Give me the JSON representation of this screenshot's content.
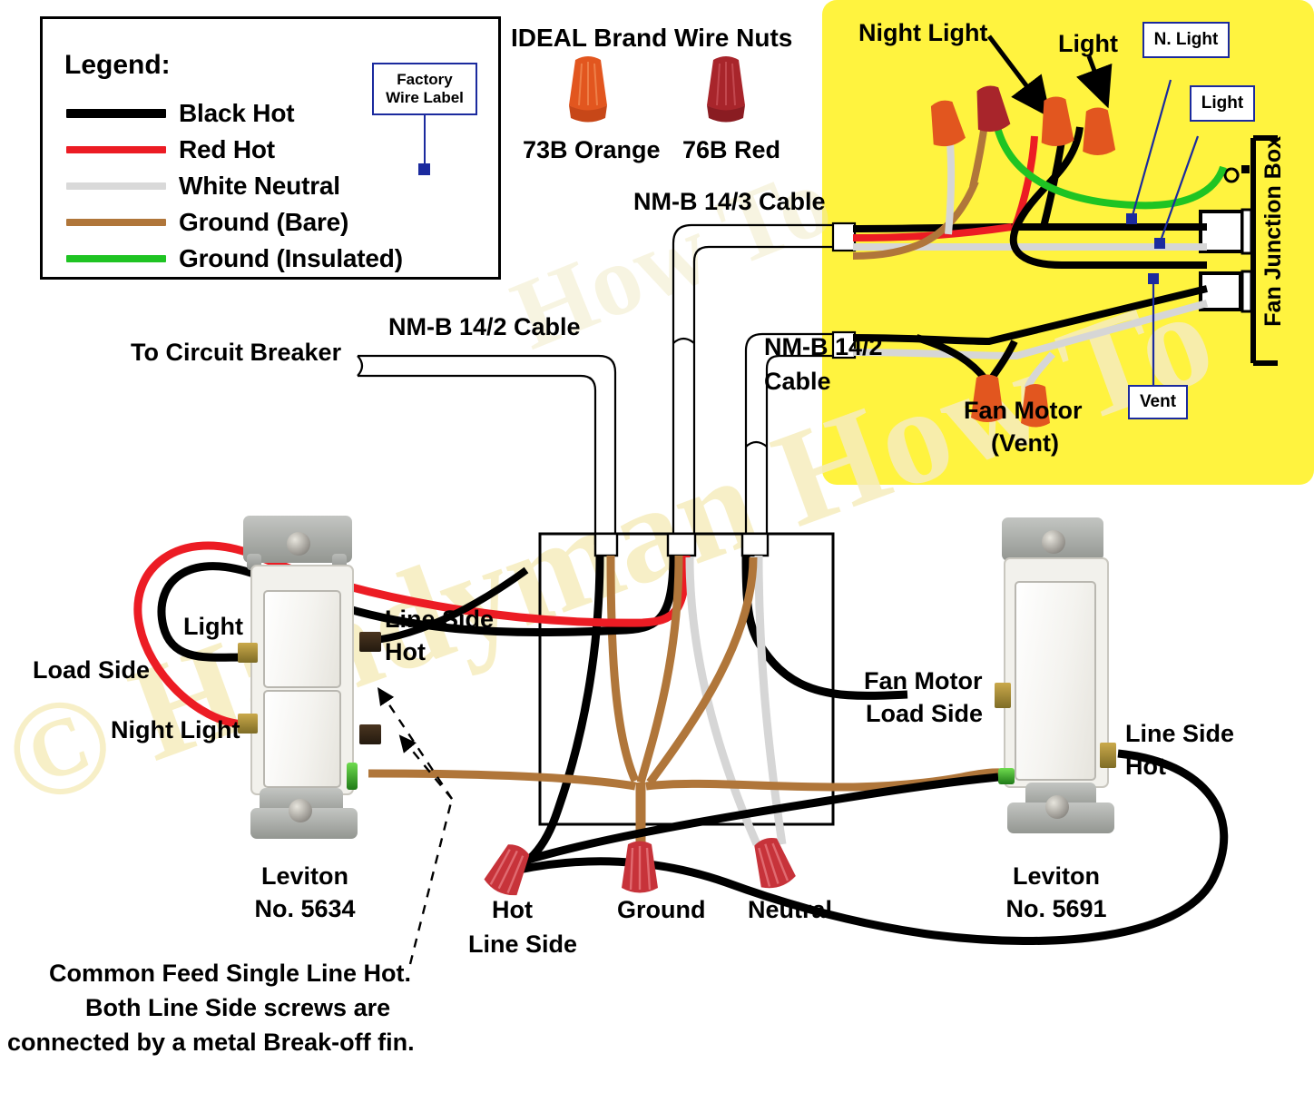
{
  "legend": {
    "title": "Legend:",
    "items": [
      {
        "label": "Black Hot",
        "color": "#000000"
      },
      {
        "label": "Red Hot",
        "color": "#ec1c24"
      },
      {
        "label": "White Neutral",
        "color": "#d9d9d9"
      },
      {
        "label": "Ground (Bare)",
        "color": "#b0763a"
      },
      {
        "label": "Ground (Insulated)",
        "color": "#1fc423"
      }
    ],
    "factory_label_line1": "Factory",
    "factory_label_line2": "Wire Label"
  },
  "wire_nuts": {
    "title": "IDEAL Brand Wire Nuts",
    "orange_caption": "73B Orange",
    "red_caption": "76B Red",
    "orange_color": "#e2561f",
    "red_color": "#a8252b"
  },
  "cables": {
    "to_breaker": "To Circuit Breaker",
    "nmb_14_2_top": "NM-B 14/2 Cable",
    "nmb_14_3": "NM-B 14/3 Cable",
    "nmb_14_2_right_line1": "NM-B 14/2",
    "nmb_14_2_right_line2": "Cable"
  },
  "fan_box": {
    "background": "#fff33f",
    "night_light": "Night Light",
    "light": "Light",
    "fan_motor_line1": "Fan Motor",
    "fan_motor_line2": "(Vent)",
    "junction_box_label": "Fan Junction Box",
    "callouts": [
      {
        "name": "n-light",
        "label": "N. Light"
      },
      {
        "name": "light",
        "label": "Light"
      },
      {
        "name": "vent",
        "label": "Vent"
      }
    ]
  },
  "left_switch": {
    "brand": "Leviton",
    "model": "No. 5634",
    "load_side": "Load Side",
    "light_terminal": "Light",
    "night_light_terminal": "Night Light",
    "line_side_line1": "Line Side",
    "line_side_line2": "Hot"
  },
  "right_switch": {
    "brand": "Leviton",
    "model": "No. 5691",
    "fan_motor_line1": "Fan Motor",
    "fan_motor_line2": "Load Side",
    "line_side_line1": "Line Side",
    "line_side_line2": "Hot"
  },
  "splices": {
    "hot_line1": "Hot",
    "hot_line2": "Line Side",
    "ground": "Ground",
    "neutral": "Neutral"
  },
  "footnote": {
    "line1": "Common Feed Single Line Hot.",
    "line2": "Both Line Side screws are",
    "line3": "connected by a metal Break-off fin."
  },
  "watermark": {
    "text": "© Handyman How To",
    "text2": "How To"
  }
}
